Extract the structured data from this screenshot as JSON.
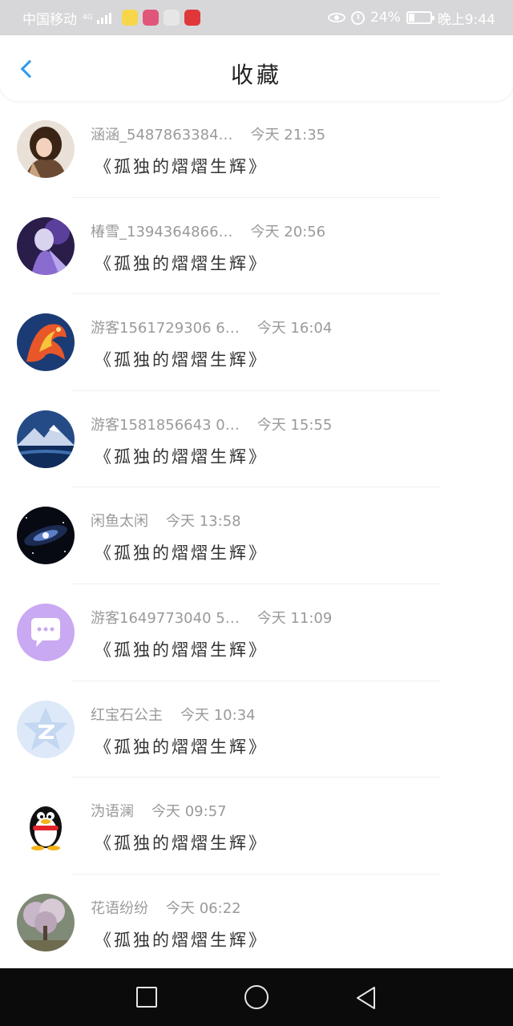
{
  "status_bar": {
    "carrier": "中国移动",
    "network": "4G",
    "battery_text": "24%",
    "battery_level": 0.24,
    "time": "晚上9:44",
    "app_icons": [
      {
        "name": "duck-app-icon",
        "color": "#f7d64a"
      },
      {
        "name": "colorful-app-icon",
        "color": "#e0567a"
      },
      {
        "name": "send-app-icon",
        "color": "#e6e6e6"
      },
      {
        "name": "huawei-app-icon",
        "color": "#e0373b"
      }
    ]
  },
  "header": {
    "title": "收藏",
    "accent_color": "#2b9bf0"
  },
  "items": [
    {
      "name": "涵涵_5487863384…",
      "time": "今天 21:35",
      "content": "《孤独的熠熠生辉》",
      "avatar": "anime-girl-avatar"
    },
    {
      "name": "椿雪_1394364866…",
      "time": "今天 20:56",
      "content": "《孤独的熠熠生辉》",
      "avatar": "anime-character-avatar"
    },
    {
      "name": "游客1561729306 6…",
      "time": "今天 16:04",
      "content": "《孤独的熠熠生辉》",
      "avatar": "phoenix-avatar"
    },
    {
      "name": "游客1581856643 0…",
      "time": "今天 15:55",
      "content": "《孤独的熠熠生辉》",
      "avatar": "mountain-lake-avatar"
    },
    {
      "name": "闲鱼太闲",
      "time": "今天 13:58",
      "content": "《孤独的熠熠生辉》",
      "avatar": "galaxy-avatar"
    },
    {
      "name": "游客1649773040 5…",
      "time": "今天 11:09",
      "content": "《孤独的熠熠生辉》",
      "avatar": "chat-bubble-avatar"
    },
    {
      "name": "红宝石公主",
      "time": "今天 10:34",
      "content": "《孤独的熠熠生辉》",
      "avatar": "qzone-star-avatar"
    },
    {
      "name": "沩语澜",
      "time": "今天 09:57",
      "content": "《孤独的熠熠生辉》",
      "avatar": "qq-penguin-avatar"
    },
    {
      "name": "花语纷纷",
      "time": "今天 06:22",
      "content": "《孤独的熠熠生辉》",
      "avatar": "blossom-tree-avatar"
    }
  ]
}
